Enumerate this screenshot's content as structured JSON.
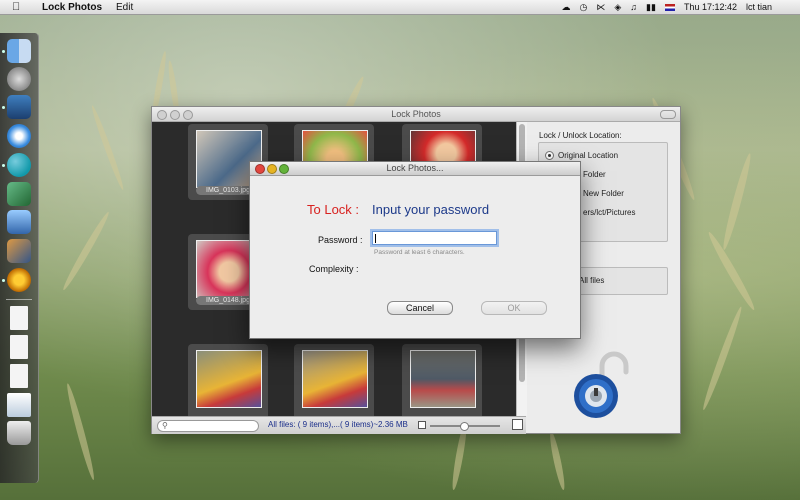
{
  "menubar": {
    "app_name": "Lock Photos",
    "menu_edit": "Edit",
    "clock": "Thu 17:12:42",
    "user": "lct tian"
  },
  "dock": {
    "items": [
      "finder-icon",
      "launchpad-icon",
      "activity-monitor-icon",
      "safari-icon",
      "messenger-icon",
      "file-merge-icon",
      "app-store-icon",
      "preview-icon",
      "system-preferences-icon",
      "document-icon",
      "icns-document-icon",
      "text-document-icon",
      "downloads-stack-icon",
      "trash-icon"
    ]
  },
  "main_window": {
    "title": "Lock Photos",
    "thumbnails": [
      {
        "label": "IMG_0103.jpg"
      },
      {
        "label": ""
      },
      {
        "label": ""
      },
      {
        "label": "IMG_0148.jpg"
      },
      {
        "label": ""
      },
      {
        "label": ""
      },
      {
        "label": ""
      },
      {
        "label": ""
      },
      {
        "label": ""
      }
    ],
    "status": "All files: ( 9 items),...( 9 items)~2.36 MB",
    "right_pane": {
      "section_label": "Lock / Unlock  Location:",
      "options": [
        "Original Location",
        "Folder",
        "New Folder",
        "ers/lct/Pictures"
      ],
      "selected_option": "Original Location",
      "files_label": "All files"
    }
  },
  "dialog": {
    "title": "Lock Photos...",
    "heading_lock": "To Lock :",
    "heading_input": "Input your password",
    "password_label": "Password :",
    "password_value": "",
    "password_hint": "Password at least  6 characters.",
    "complexity_label": "Complexity :",
    "cancel_label": "Cancel",
    "ok_label": "OK"
  },
  "colors": {
    "lock_red": "#d8211f",
    "input_blue": "#1d3a8a",
    "status_blue": "#1a2e8a"
  }
}
